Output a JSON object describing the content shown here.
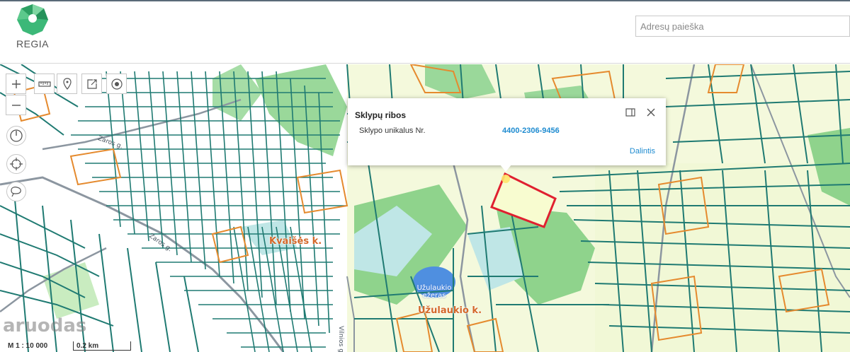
{
  "header": {
    "brand": "REGIA",
    "search_placeholder": "Adresų paieška"
  },
  "toolbar": {
    "zoom_in": "+",
    "zoom_out": "−"
  },
  "colors": {
    "parcel_line": "#1f7a72",
    "orange_parcel": "#e58a2e",
    "forest": "#8fd38c",
    "field": "#f3f8d8",
    "water": "#4f8fe0",
    "selection": "#e02030",
    "link": "#1e8bd0"
  },
  "popup": {
    "title": "Sklypų ribos",
    "key": "Sklypo unikalus Nr.",
    "value": "4400-2306-9456",
    "share": "Dalintis"
  },
  "map": {
    "places": [
      "Kvaišės k.",
      "Užulaukio k."
    ],
    "lake": [
      "Užulaukio",
      "ežeras"
    ],
    "roads": [
      "Zaros g.",
      "Zaros g.",
      "Vilnios g."
    ]
  },
  "footer": {
    "scale": "M 1 : 10 000",
    "scale_bar": "0.2 km",
    "watermark": "aruodas"
  }
}
